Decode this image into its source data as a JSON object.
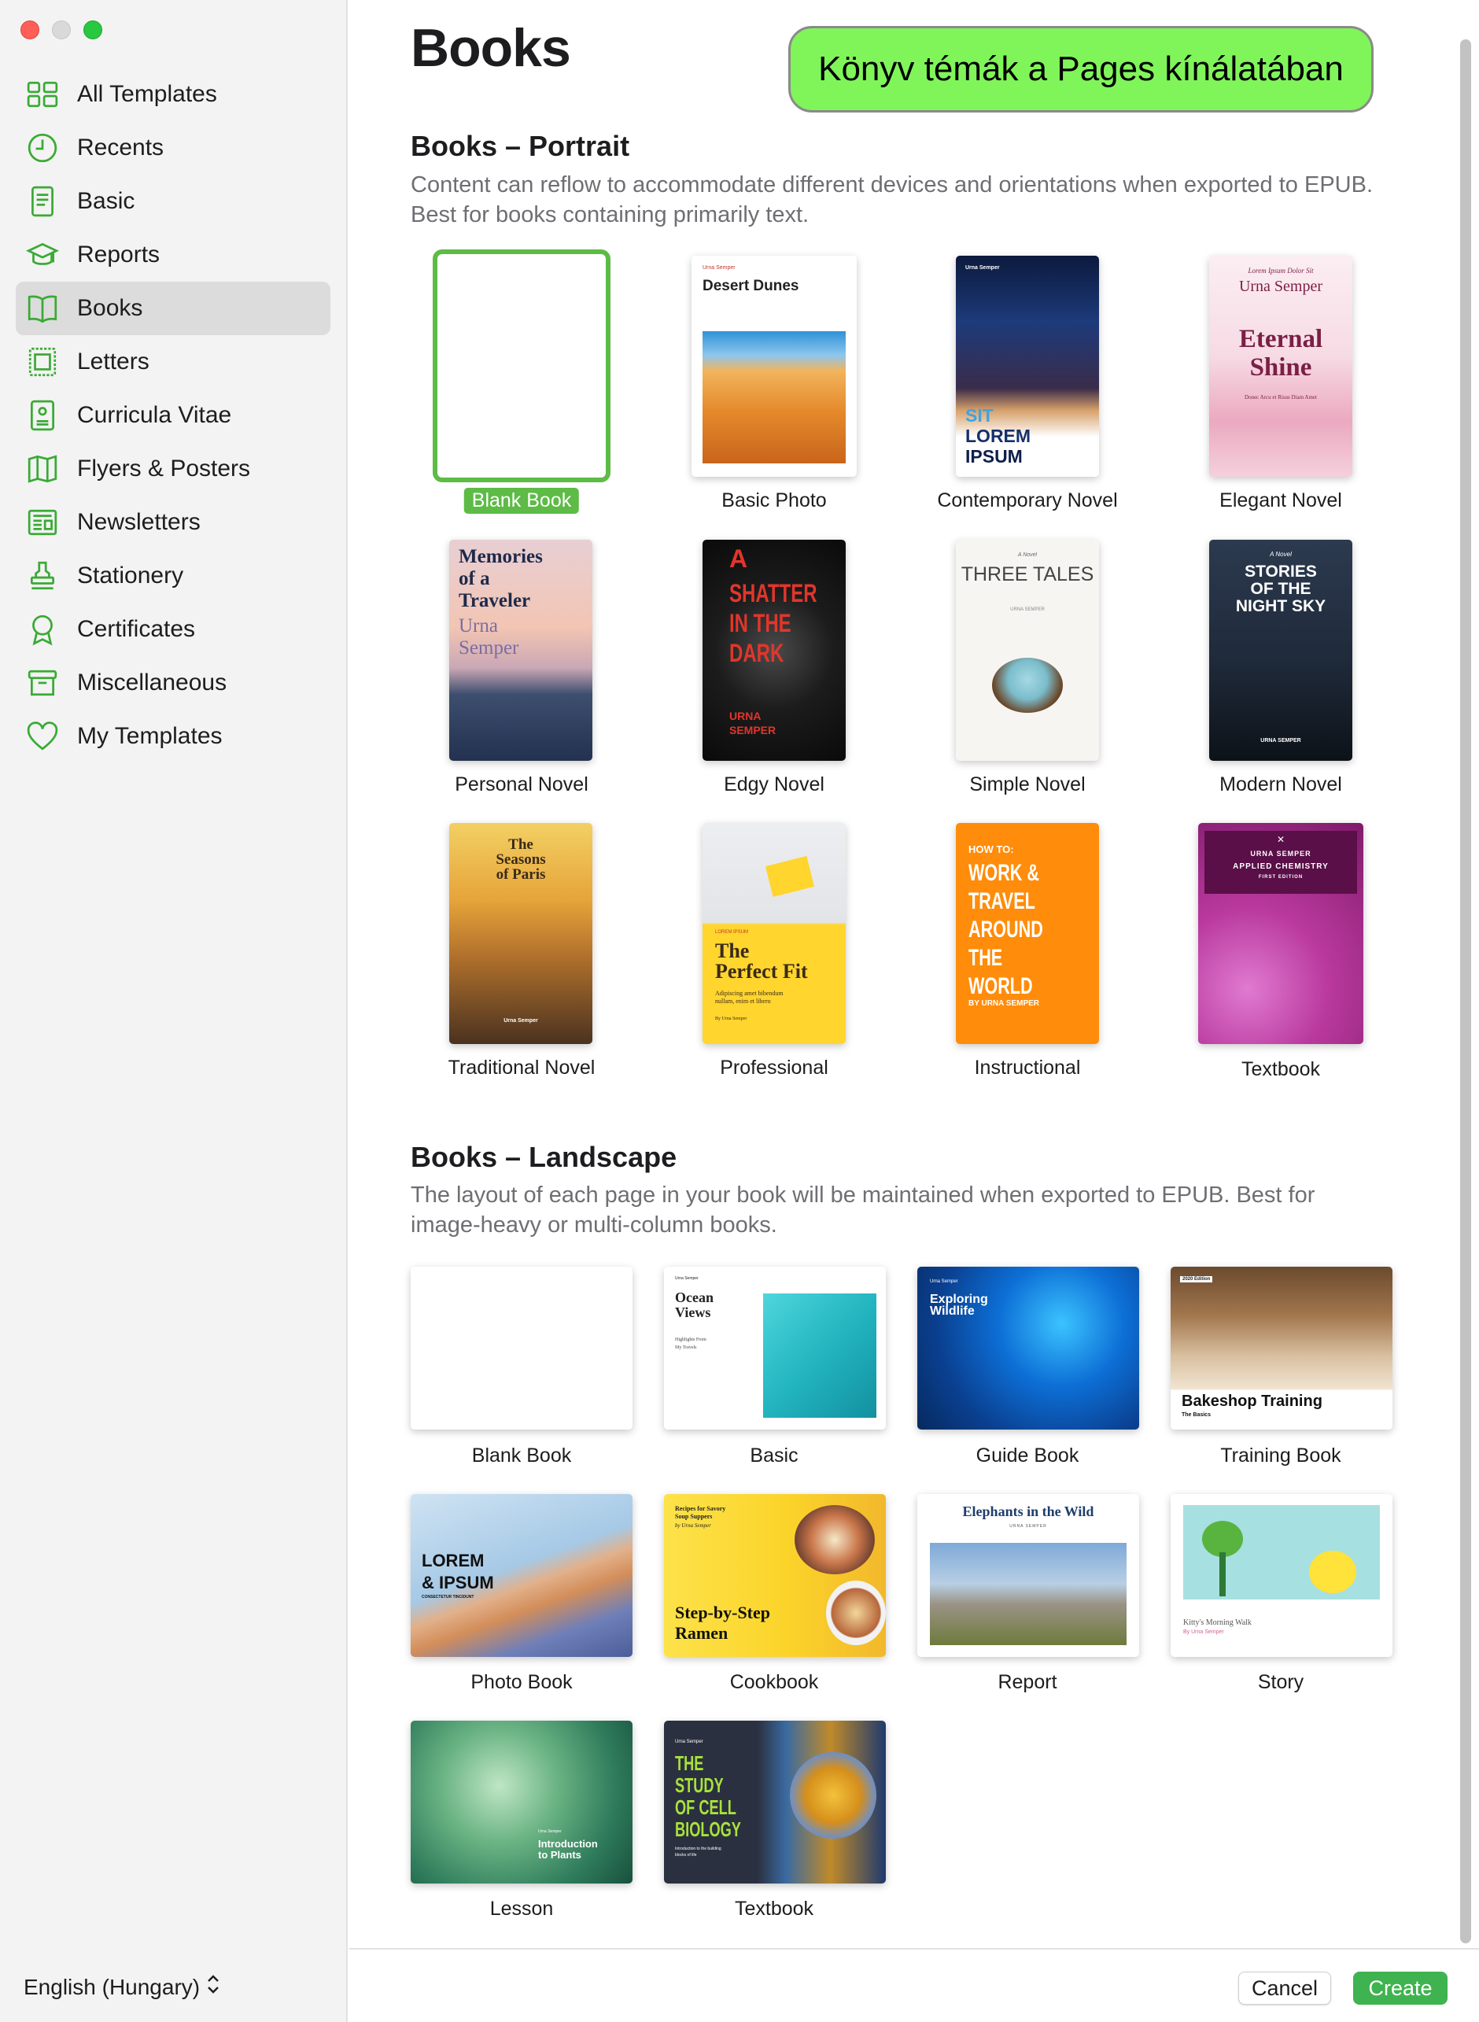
{
  "window": {
    "traffic_lights": [
      "close",
      "minimize",
      "zoom"
    ]
  },
  "sidebar": {
    "items": [
      {
        "label": "All Templates",
        "icon": "grid-icon"
      },
      {
        "label": "Recents",
        "icon": "clock-icon"
      },
      {
        "label": "Basic",
        "icon": "document-icon"
      },
      {
        "label": "Reports",
        "icon": "graduation-cap-icon"
      },
      {
        "label": "Books",
        "icon": "book-icon",
        "active": true
      },
      {
        "label": "Letters",
        "icon": "letter-icon"
      },
      {
        "label": "Curricula Vitae",
        "icon": "id-badge-icon"
      },
      {
        "label": "Flyers & Posters",
        "icon": "map-icon"
      },
      {
        "label": "Newsletters",
        "icon": "newspaper-icon"
      },
      {
        "label": "Stationery",
        "icon": "stamp-icon"
      },
      {
        "label": "Certificates",
        "icon": "ribbon-icon"
      },
      {
        "label": "Miscellaneous",
        "icon": "archive-icon"
      },
      {
        "label": "My Templates",
        "icon": "heart-icon"
      }
    ],
    "language": "English (Hungary)"
  },
  "main": {
    "title": "Books",
    "callout": "Könyv témák a Pages kínálatában",
    "portrait": {
      "title": "Books – Portrait",
      "description": "Content can reflow to accommodate different devices and orientations when exported to EPUB. Best for books containing primarily text.",
      "templates": [
        {
          "label": "Blank Book",
          "selected": true
        },
        {
          "label": "Basic Photo",
          "cover_text": [
            "Urna Semper",
            "Desert Dunes"
          ]
        },
        {
          "label": "Contemporary Novel",
          "cover_text": [
            "Urna Semper",
            "SIT",
            "LOREM",
            "IPSUM"
          ]
        },
        {
          "label": "Elegant Novel",
          "cover_text": [
            "Lorem Ipsum Dolor Sit",
            "Urna Semper",
            "Eternal",
            "Shine",
            "Donec Arcu et Risus Diam Amet"
          ]
        },
        {
          "label": "Personal Novel",
          "cover_text": [
            "Memories",
            "of a",
            "Traveler",
            "Urna",
            "Semper"
          ]
        },
        {
          "label": "Edgy Novel",
          "cover_text": [
            "A",
            "SHATTER",
            "IN THE",
            "DARK",
            "URNA",
            "SEMPER"
          ]
        },
        {
          "label": "Simple Novel",
          "cover_text": [
            "A Novel",
            "THREE TALES",
            "URNA SEMPER"
          ]
        },
        {
          "label": "Modern Novel",
          "cover_text": [
            "A Novel",
            "STORIES",
            "OF THE",
            "NIGHT SKY",
            "URNA SEMPER"
          ]
        },
        {
          "label": "Traditional Novel",
          "cover_text": [
            "The",
            "Seasons",
            "of Paris",
            "Urna Semper"
          ]
        },
        {
          "label": "Professional",
          "cover_text": [
            "LOREM IPSUM",
            "The",
            "Perfect Fit",
            "Adipiscing amet bibendum",
            "nullam, enim et libero",
            "By Urna Semper"
          ]
        },
        {
          "label": "Instructional",
          "cover_text": [
            "HOW TO:",
            "WORK &",
            "TRAVEL",
            "AROUND",
            "THE WORLD",
            "BY URNA SEMPER"
          ]
        },
        {
          "label": "Textbook",
          "cover_text": [
            "URNA SEMPER",
            "APPLIED CHEMISTRY",
            "FIRST EDITION"
          ]
        }
      ]
    },
    "landscape": {
      "title": "Books – Landscape",
      "description": "The layout of each page in your book will be maintained when exported to EPUB. Best for image-heavy or multi-column books.",
      "templates": [
        {
          "label": "Blank Book"
        },
        {
          "label": "Basic",
          "cover_text": [
            "Urna Semper",
            "Ocean",
            "Views",
            "Highlights From",
            "My Travels"
          ]
        },
        {
          "label": "Guide Book",
          "cover_text": [
            "Urna Semper",
            "Exploring",
            "Wildlife"
          ]
        },
        {
          "label": "Training Book",
          "cover_text": [
            "2020 Edition",
            "Bakeshop Training",
            "The Basics"
          ]
        },
        {
          "label": "Photo Book",
          "cover_text": [
            "LOREM",
            "& IPSUM",
            "CONSECTETUR TINCIDUNT"
          ]
        },
        {
          "label": "Cookbook",
          "cover_text": [
            "Recipes for Savory",
            "Soup Suppers",
            "by Urna Semper",
            "Step-by-Step",
            "Ramen"
          ]
        },
        {
          "label": "Report",
          "cover_text": [
            "Elephants in the Wild",
            "URNA SEMPER"
          ]
        },
        {
          "label": "Story",
          "cover_text": [
            "Kitty's Morning Walk",
            "By Urna Semper"
          ]
        },
        {
          "label": "Lesson",
          "cover_text": [
            "Urna Semper",
            "Introduction",
            "to Plants"
          ]
        },
        {
          "label": "Textbook",
          "cover_text": [
            "Urna Semper",
            "THE",
            "STUDY",
            "OF CELL",
            "BIOLOGY",
            "Introduction to the building",
            "blocks of life"
          ]
        }
      ]
    }
  },
  "footer": {
    "cancel": "Cancel",
    "create": "Create"
  },
  "colors": {
    "accent": "#5dbb46",
    "callout": "#80f55a",
    "create": "#3fb34f",
    "sidebar_icon": "#3aaa35"
  }
}
